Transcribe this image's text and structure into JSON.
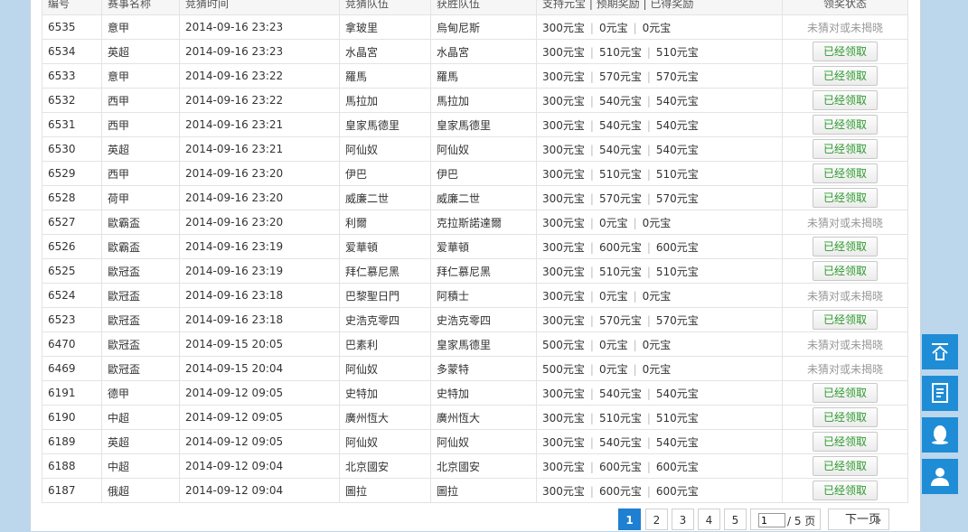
{
  "headers": [
    "编号",
    "赛事名称",
    "竞猜时间",
    "竞猜队伍",
    "获胜队伍",
    "支持元宝 | 预期奖励 | 已得奖励",
    "领奖状态"
  ],
  "rows": [
    {
      "id": "6535",
      "league": "意甲",
      "time": "2014-09-16 23:23",
      "team": "拿玻里",
      "winner": "烏甸尼斯",
      "stake": "300元宝",
      "expected": "0元宝",
      "earned": "0元宝",
      "status": "未猜对或未揭晓",
      "claimed": false
    },
    {
      "id": "6534",
      "league": "英超",
      "time": "2014-09-16 23:23",
      "team": "水晶宮",
      "winner": "水晶宮",
      "stake": "300元宝",
      "expected": "510元宝",
      "earned": "510元宝",
      "status": "已经领取",
      "claimed": true
    },
    {
      "id": "6533",
      "league": "意甲",
      "time": "2014-09-16 23:22",
      "team": "羅馬",
      "winner": "羅馬",
      "stake": "300元宝",
      "expected": "570元宝",
      "earned": "570元宝",
      "status": "已经领取",
      "claimed": true
    },
    {
      "id": "6532",
      "league": "西甲",
      "time": "2014-09-16 23:22",
      "team": "馬拉加",
      "winner": "馬拉加",
      "stake": "300元宝",
      "expected": "540元宝",
      "earned": "540元宝",
      "status": "已经领取",
      "claimed": true
    },
    {
      "id": "6531",
      "league": "西甲",
      "time": "2014-09-16 23:21",
      "team": "皇家馬德里",
      "winner": "皇家馬德里",
      "stake": "300元宝",
      "expected": "540元宝",
      "earned": "540元宝",
      "status": "已经领取",
      "claimed": true
    },
    {
      "id": "6530",
      "league": "英超",
      "time": "2014-09-16 23:21",
      "team": "阿仙奴",
      "winner": "阿仙奴",
      "stake": "300元宝",
      "expected": "540元宝",
      "earned": "540元宝",
      "status": "已经领取",
      "claimed": true
    },
    {
      "id": "6529",
      "league": "西甲",
      "time": "2014-09-16 23:20",
      "team": "伊巴",
      "winner": "伊巴",
      "stake": "300元宝",
      "expected": "510元宝",
      "earned": "510元宝",
      "status": "已经领取",
      "claimed": true
    },
    {
      "id": "6528",
      "league": "荷甲",
      "time": "2014-09-16 23:20",
      "team": "威廉二世",
      "winner": "威廉二世",
      "stake": "300元宝",
      "expected": "570元宝",
      "earned": "570元宝",
      "status": "已经领取",
      "claimed": true
    },
    {
      "id": "6527",
      "league": "歐霸盃",
      "time": "2014-09-16 23:20",
      "team": "利爾",
      "winner": "克拉斯諾達爾",
      "stake": "300元宝",
      "expected": "0元宝",
      "earned": "0元宝",
      "status": "未猜对或未揭晓",
      "claimed": false
    },
    {
      "id": "6526",
      "league": "歐霸盃",
      "time": "2014-09-16 23:19",
      "team": "爱華頓",
      "winner": "爱華頓",
      "stake": "300元宝",
      "expected": "600元宝",
      "earned": "600元宝",
      "status": "已经领取",
      "claimed": true
    },
    {
      "id": "6525",
      "league": "歐冠盃",
      "time": "2014-09-16 23:19",
      "team": "拜仁慕尼黑",
      "winner": "拜仁慕尼黑",
      "stake": "300元宝",
      "expected": "510元宝",
      "earned": "510元宝",
      "status": "已经领取",
      "claimed": true
    },
    {
      "id": "6524",
      "league": "歐冠盃",
      "time": "2014-09-16 23:18",
      "team": "巴黎聖日門",
      "winner": "阿積士",
      "stake": "300元宝",
      "expected": "0元宝",
      "earned": "0元宝",
      "status": "未猜对或未揭晓",
      "claimed": false
    },
    {
      "id": "6523",
      "league": "歐冠盃",
      "time": "2014-09-16 23:18",
      "team": "史浩克零四",
      "winner": "史浩克零四",
      "stake": "300元宝",
      "expected": "570元宝",
      "earned": "570元宝",
      "status": "已经领取",
      "claimed": true
    },
    {
      "id": "6470",
      "league": "歐冠盃",
      "time": "2014-09-15 20:05",
      "team": "巴素利",
      "winner": "皇家馬德里",
      "stake": "500元宝",
      "expected": "0元宝",
      "earned": "0元宝",
      "status": "未猜对或未揭晓",
      "claimed": false
    },
    {
      "id": "6469",
      "league": "歐冠盃",
      "time": "2014-09-15 20:04",
      "team": "阿仙奴",
      "winner": "多蒙特",
      "stake": "500元宝",
      "expected": "0元宝",
      "earned": "0元宝",
      "status": "未猜对或未揭晓",
      "claimed": false
    },
    {
      "id": "6191",
      "league": "德甲",
      "time": "2014-09-12 09:05",
      "team": "史特加",
      "winner": "史特加",
      "stake": "300元宝",
      "expected": "540元宝",
      "earned": "540元宝",
      "status": "已经领取",
      "claimed": true
    },
    {
      "id": "6190",
      "league": "中超",
      "time": "2014-09-12 09:05",
      "team": "廣州恆大",
      "winner": "廣州恆大",
      "stake": "300元宝",
      "expected": "510元宝",
      "earned": "510元宝",
      "status": "已经领取",
      "claimed": true
    },
    {
      "id": "6189",
      "league": "英超",
      "time": "2014-09-12 09:05",
      "team": "阿仙奴",
      "winner": "阿仙奴",
      "stake": "300元宝",
      "expected": "540元宝",
      "earned": "540元宝",
      "status": "已经领取",
      "claimed": true
    },
    {
      "id": "6188",
      "league": "中超",
      "time": "2014-09-12 09:04",
      "team": "北京國安",
      "winner": "北京國安",
      "stake": "300元宝",
      "expected": "600元宝",
      "earned": "600元宝",
      "status": "已经领取",
      "claimed": true
    },
    {
      "id": "6187",
      "league": "俄超",
      "time": "2014-09-12 09:04",
      "team": "圖拉",
      "winner": "圖拉",
      "stake": "300元宝",
      "expected": "600元宝",
      "earned": "600元宝",
      "status": "已经领取",
      "claimed": true
    }
  ],
  "pager": {
    "pages": [
      "1",
      "2",
      "3",
      "4",
      "5"
    ],
    "current_page": "1",
    "total_label": "/ 5 页",
    "next_label": "下一页"
  },
  "side_tools": [
    {
      "icon": "back-to-top-icon"
    },
    {
      "icon": "notes-icon"
    },
    {
      "icon": "qq-icon"
    },
    {
      "icon": "customer-service-icon"
    }
  ],
  "colors": {
    "accent": "#1e8dd6",
    "claimed_text": "#2e9a2e",
    "muted": "#999999"
  }
}
